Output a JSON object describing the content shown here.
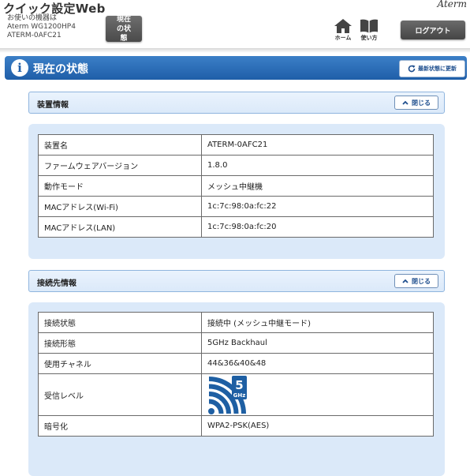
{
  "header": {
    "app_title": "クイック設定Web",
    "device_caption": "お使いの機器は",
    "device_model": "Aterm WG1200HP4",
    "device_name": "ATERM-0AFC21",
    "status_button": "現在の状態",
    "logo": "Aterm",
    "nav": {
      "home": "ホーム",
      "help": "使い方"
    },
    "logout": "ログアウト"
  },
  "page": {
    "title": "現在の状態",
    "refresh_button": "最新状態に更新"
  },
  "device_section": {
    "title": "装置情報",
    "close_button": "閉じる",
    "rows": [
      {
        "label": "装置名",
        "value": "ATERM-0AFC21"
      },
      {
        "label": "ファームウェアバージョン",
        "value": "1.8.0"
      },
      {
        "label": "動作モード",
        "value": "メッシュ中継機"
      },
      {
        "label": "MACアドレス(Wi-Fi)",
        "value": "1c:7c:98:0a:fc:22"
      },
      {
        "label": "MACアドレス(LAN)",
        "value": "1c:7c:98:0a:fc:20"
      }
    ]
  },
  "connection_section": {
    "title": "接続先情報",
    "close_button": "閉じる",
    "rows": [
      {
        "label": "接続状態",
        "value": "接続中 (メッシュ中継モード)"
      },
      {
        "label": "接続形態",
        "value": "5GHz Backhaul"
      },
      {
        "label": "使用チャネル",
        "value": "44&36&40&48"
      },
      {
        "label": "受信レベル",
        "value": ""
      },
      {
        "label": "暗号化",
        "value": "WPA2-PSK(AES)"
      }
    ],
    "signal": {
      "band_number": "5",
      "band_unit": "GHz",
      "bars": 4,
      "max_bars": 4,
      "color": "#1e5fa3"
    }
  },
  "colors": {
    "accent": "#1f5ea8",
    "panel": "#dbe9f9",
    "button_dark": "#4a4a4a"
  }
}
